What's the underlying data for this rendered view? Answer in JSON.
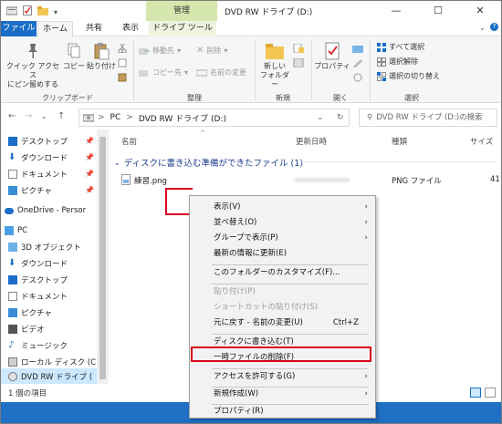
{
  "window": {
    "title": "DVD RW ドライブ (D:)",
    "manage_label": "管理",
    "controls": {
      "minimize": "—",
      "maximize": "☐",
      "close": "✕"
    }
  },
  "tabs": {
    "file": "ファイル",
    "home": "ホーム",
    "share": "共有",
    "view": "表示",
    "drive_tools": "ドライブ ツール"
  },
  "ribbon": {
    "clipboard": {
      "label": "クリップボード",
      "pin": "クイック アクセス\nにピン留めする",
      "copy": "コピー",
      "paste": "貼り付け"
    },
    "organize": {
      "label": "整理",
      "move_to": "移動先",
      "copy_to": "コピー先",
      "delete": "削除",
      "rename": "名前の変更"
    },
    "new": {
      "label": "新規",
      "new_folder": "新しい\nフォルダー"
    },
    "open": {
      "label": "開く",
      "properties": "プロパティ"
    },
    "select": {
      "label": "選択",
      "select_all": "すべて選択",
      "select_none": "選択解除",
      "invert": "選択の切り替え"
    }
  },
  "address": {
    "path_pc": "PC",
    "path_sep": ">",
    "path_drive": "DVD RW ドライブ (D:)",
    "search_placeholder": "DVD RW ドライブ (D:)の検索"
  },
  "nav": {
    "quick": [
      {
        "label": "デスクトップ"
      },
      {
        "label": "ダウンロード"
      },
      {
        "label": "ドキュメント"
      },
      {
        "label": "ピクチャ"
      }
    ],
    "onedrive": "OneDrive - Persor",
    "pc": "PC",
    "pc_items": [
      {
        "label": "3D オブジェクト"
      },
      {
        "label": "ダウンロード"
      },
      {
        "label": "デスクトップ"
      },
      {
        "label": "ドキュメント"
      },
      {
        "label": "ピクチャ"
      },
      {
        "label": "ビデオ"
      },
      {
        "label": "ミュージック"
      },
      {
        "label": "ローカル ディスク (C"
      },
      {
        "label": "DVD RW ドライブ ("
      }
    ]
  },
  "columns": {
    "name": "名前",
    "date": "更新日時",
    "type": "種類",
    "size": "サイズ"
  },
  "group_header": "ディスクに書き込む準備ができたファイル (1)",
  "files": [
    {
      "name": "練習.png",
      "type": "PNG ファイル",
      "size": "41"
    }
  ],
  "status": {
    "count": "1 個の項目"
  },
  "context_menu": {
    "view": "表示(V)",
    "sort": "並べ替え(O)",
    "group": "グループで表示(P)",
    "refresh": "最新の情報に更新(E)",
    "customize": "このフォルダーのカスタマイズ(F)...",
    "paste": "貼り付け(P)",
    "paste_shortcut": "ショートカットの貼り付け(S)",
    "undo": "元に戻す - 名前の変更(U)",
    "undo_shortcut": "Ctrl+Z",
    "burn": "ディスクに書き込む(T)",
    "delete_temp": "一時ファイルの削除(F)",
    "grant_access": "アクセスを許可する(G)",
    "new": "新規作成(W)",
    "properties": "プロパティ(R)"
  },
  "colors": {
    "accent": "#1a6ec7",
    "highlight": "#d9001b",
    "manage": "#d6e7ad",
    "selected": "#cce8ff"
  }
}
